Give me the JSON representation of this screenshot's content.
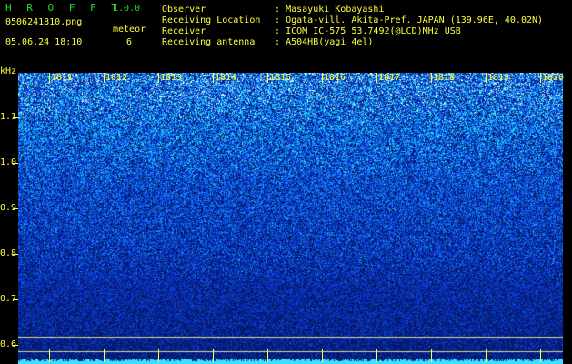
{
  "header": {
    "app_name": "H R O F F T",
    "version": "1.0.0",
    "filename": "0506241810.png",
    "datetime": "05.06.24 18:10",
    "count_label": "meteor",
    "count_value": "6"
  },
  "station": {
    "rows": [
      {
        "key": "Observer",
        "sep": ":",
        "value": "Masayuki Kobayashi"
      },
      {
        "key": "Receiving Location",
        "sep": ":",
        "value": "Ogata-vill. Akita-Pref. JAPAN (139.96E, 40.02N)"
      },
      {
        "key": "Receiver",
        "sep": ":",
        "value": "ICOM IC-575 53.7492(@LCD)MHz USB"
      },
      {
        "key": "Receiving antenna",
        "sep": ":",
        "value": "A504HB(yagi 4el)"
      }
    ]
  },
  "chart_data": {
    "type": "heatmap",
    "ylabel": "kHz",
    "y_ticks": [
      "1.1",
      "1.0",
      "0.9",
      "0.8",
      "0.7",
      "0.6"
    ],
    "x_ticks": [
      "1811",
      "1812",
      "1813",
      "1814",
      "1815",
      "1816",
      "1817",
      "1818",
      "1819",
      "1820"
    ],
    "colors": {
      "background": "#000000",
      "low": "#0a1a7a",
      "mid": "#1e5aff",
      "high": "#39e0ff",
      "peak": "#ffffff",
      "text": "#ffff40",
      "title": "#22dd22"
    }
  }
}
